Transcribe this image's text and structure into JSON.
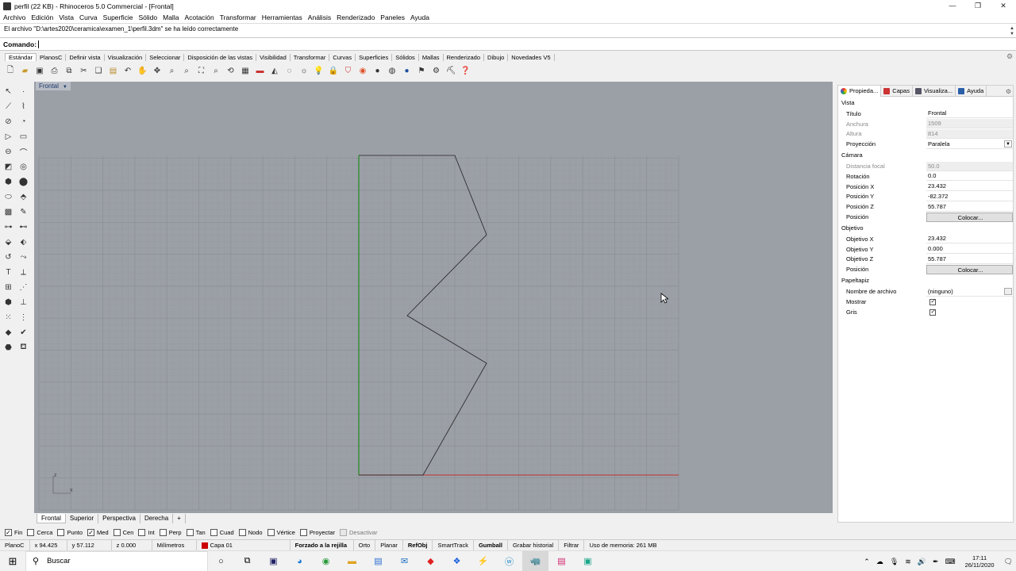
{
  "window": {
    "title": "perfil (22 KB) - Rhinoceros 5.0 Commercial - [Frontal]",
    "controls": [
      "—",
      "❐",
      "✕"
    ]
  },
  "menu": [
    "Archivo",
    "Edición",
    "Vista",
    "Curva",
    "Superficie",
    "Sólido",
    "Malla",
    "Acotación",
    "Transformar",
    "Herramientas",
    "Análisis",
    "Renderizado",
    "Paneles",
    "Ayuda"
  ],
  "history": "El archivo \"D:\\artes2020\\ceramica\\examen_1\\perfil.3dm\" se ha leído correctamente",
  "command": {
    "label": "Comando:",
    "value": ""
  },
  "toolbar_tabs": [
    "Estándar",
    "PlanosC",
    "Definir vista",
    "Visualización",
    "Seleccionar",
    "Disposición de las vistas",
    "Visibilidad",
    "Transformar",
    "Curvas",
    "Superficies",
    "Sólidos",
    "Mallas",
    "Renderizado",
    "Dibujo",
    "Novedades V5"
  ],
  "viewport": {
    "name": "Frontal"
  },
  "viewport_tabs": [
    "Frontal",
    "Superior",
    "Perspectiva",
    "Derecha",
    "+"
  ],
  "osnaps": [
    {
      "label": "Fin",
      "checked": true
    },
    {
      "label": "Cerca",
      "checked": false
    },
    {
      "label": "Punto",
      "checked": false
    },
    {
      "label": "Med",
      "checked": true
    },
    {
      "label": "Cen",
      "checked": false
    },
    {
      "label": "Int",
      "checked": false
    },
    {
      "label": "Perp",
      "checked": false
    },
    {
      "label": "Tan",
      "checked": false
    },
    {
      "label": "Cuad",
      "checked": false
    },
    {
      "label": "Nodo",
      "checked": false
    },
    {
      "label": "Vértice",
      "checked": false
    },
    {
      "label": "Proyectar",
      "checked": false
    },
    {
      "label": "Desactivar",
      "checked": false
    }
  ],
  "status": {
    "cplane": "PlanoC",
    "x": "x 94.425",
    "y": "y 57.112",
    "z": "z 0.000",
    "units": "Milímetros",
    "layer": "Capa 01",
    "layer_color": "#cc0000",
    "grid_snap": "Forzado a la rejilla",
    "ortho": "Orto",
    "planar": "Planar",
    "osnap": "RefObj",
    "smarttrack": "SmartTrack",
    "gumball": "Gumball",
    "record_history": "Grabar historial",
    "filter": "Filtrar",
    "memory": "Uso de memoria: 261 MB"
  },
  "panel": {
    "tabs": [
      "Propieda...",
      "Capas",
      "Visualiza...",
      "Ayuda"
    ],
    "sections": {
      "vista": "Vista",
      "camara": "Cámara",
      "objetivo": "Objetivo",
      "papeltapiz": "Papeltapiz"
    },
    "vista_rows": [
      {
        "k": "Título",
        "v": "Frontal"
      },
      {
        "k": "Anchura",
        "v": "1509"
      },
      {
        "k": "Altura",
        "v": "814"
      },
      {
        "k": "Proyección",
        "v": "Paralela"
      }
    ],
    "camara_rows": [
      {
        "k": "Distancia focal",
        "v": "50.0"
      },
      {
        "k": "Rotación",
        "v": "0.0"
      },
      {
        "k": "Posición X",
        "v": "23.432"
      },
      {
        "k": "Posición Y",
        "v": "-82.372"
      },
      {
        "k": "Posición Z",
        "v": "55.787"
      },
      {
        "k": "Posición",
        "v": "Colocar..."
      }
    ],
    "objetivo_rows": [
      {
        "k": "Objetivo X",
        "v": "23.432"
      },
      {
        "k": "Objetivo Y",
        "v": "0.000"
      },
      {
        "k": "Objetivo Z",
        "v": "55.787"
      },
      {
        "k": "Posición",
        "v": "Colocar..."
      }
    ],
    "papeltapiz_rows": [
      {
        "k": "Nombre de archivo",
        "v": "(ninguno)"
      },
      {
        "k": "Mostrar",
        "v": "✓"
      },
      {
        "k": "Gris",
        "v": "✓"
      }
    ]
  },
  "taskbar": {
    "search": "Buscar",
    "time": "17:11",
    "date": "26/11/2020"
  },
  "axis": {
    "z": "z",
    "x": "x"
  }
}
